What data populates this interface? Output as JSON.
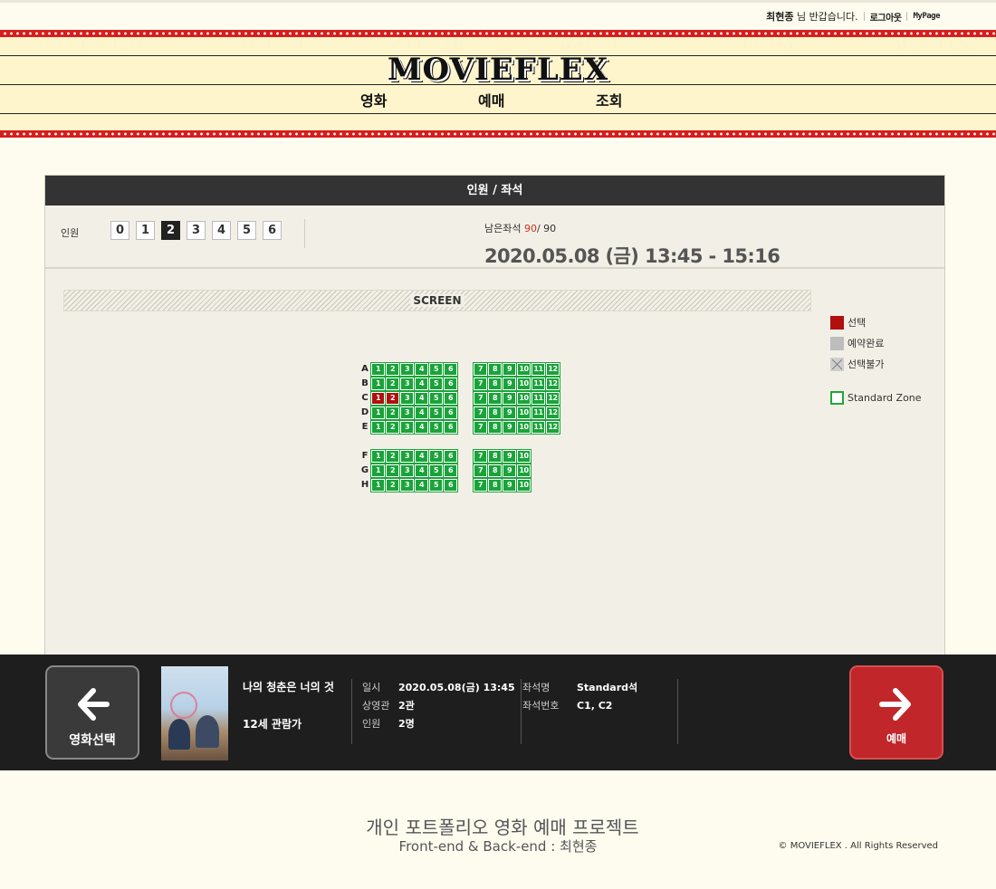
{
  "userbar": {
    "greeting_name": "최현종",
    "greeting_suffix": " 님 반갑습니다.",
    "logout": "로그아웃",
    "mypage": "MyPage"
  },
  "brand": {
    "logo": "MOVIEFLEX"
  },
  "nav": {
    "movies": "영화",
    "booking": "예매",
    "lookup": "조회"
  },
  "panel": {
    "title": "인원 / 좌석",
    "people_label": "인원",
    "counts": [
      "0",
      "1",
      "2",
      "3",
      "4",
      "5",
      "6"
    ],
    "selected_count": "2",
    "remain_label": "남은좌석",
    "remain_available": "90",
    "remain_total": "/ 90",
    "showtime": "2020.05.08 (금) 13:45 - 15:16"
  },
  "screen": {
    "label": "SCREEN"
  },
  "legend": {
    "selected": "선택",
    "reserved": "예약완료",
    "unavailable": "선택불가",
    "standard_zone": "Standard Zone"
  },
  "seatmap": {
    "rows_block1": [
      "A",
      "B",
      "C",
      "D",
      "E"
    ],
    "rows_block2": [
      "F",
      "G",
      "H"
    ],
    "left_seats": [
      "1",
      "2",
      "3",
      "4",
      "5",
      "6"
    ],
    "right_seats_full": [
      "7",
      "8",
      "9",
      "10",
      "11",
      "12"
    ],
    "right_seats_short": [
      "7",
      "8",
      "9",
      "10"
    ],
    "selected_seats": [
      "C1",
      "C2"
    ],
    "accent_color": "#1aa33a",
    "selected_color": "#b20f0f"
  },
  "summary": {
    "prev_label": "영화선택",
    "next_label": "예매",
    "movie_title": "나의 청춘은 너의 것",
    "rating": "12세 관람가",
    "date_key": "일시",
    "date_value": "2020.05.08(금) 13:45",
    "hall_key": "상영관",
    "hall_value": "2관",
    "people_key": "인원",
    "people_value": "2명",
    "seat_name_key": "좌석명",
    "seat_name_value": "Standard석",
    "seat_no_key": "좌석번호",
    "seat_no_value": "C1, C2",
    "next_color": "#c0262a"
  },
  "footer": {
    "title": "개인 포트폴리오 영화 예매 프로젝트",
    "subtitle": "Front-end & Back-end : 최현종",
    "copyright": "© MOVIEFLEX . All Rights Reserved"
  }
}
